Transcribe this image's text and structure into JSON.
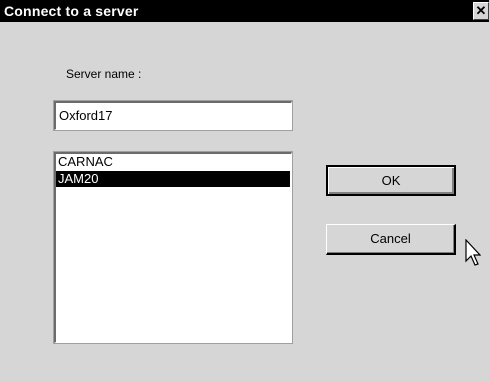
{
  "window": {
    "title": "Connect to a server",
    "close_glyph": "✕"
  },
  "form": {
    "server_name_label": "Server name :",
    "server_name_value": "Oxford17"
  },
  "server_list": {
    "items": [
      "CARNAC",
      "JAM20"
    ],
    "selected_index": 1
  },
  "buttons": {
    "ok_label": "OK",
    "cancel_label": "Cancel"
  },
  "icons": {
    "close": "close-icon",
    "cursor": "mouse-pointer-icon"
  },
  "colors": {
    "titlebar": "#000000",
    "dialog_bg": "#d6d6d6",
    "selection_bg": "#000000"
  }
}
